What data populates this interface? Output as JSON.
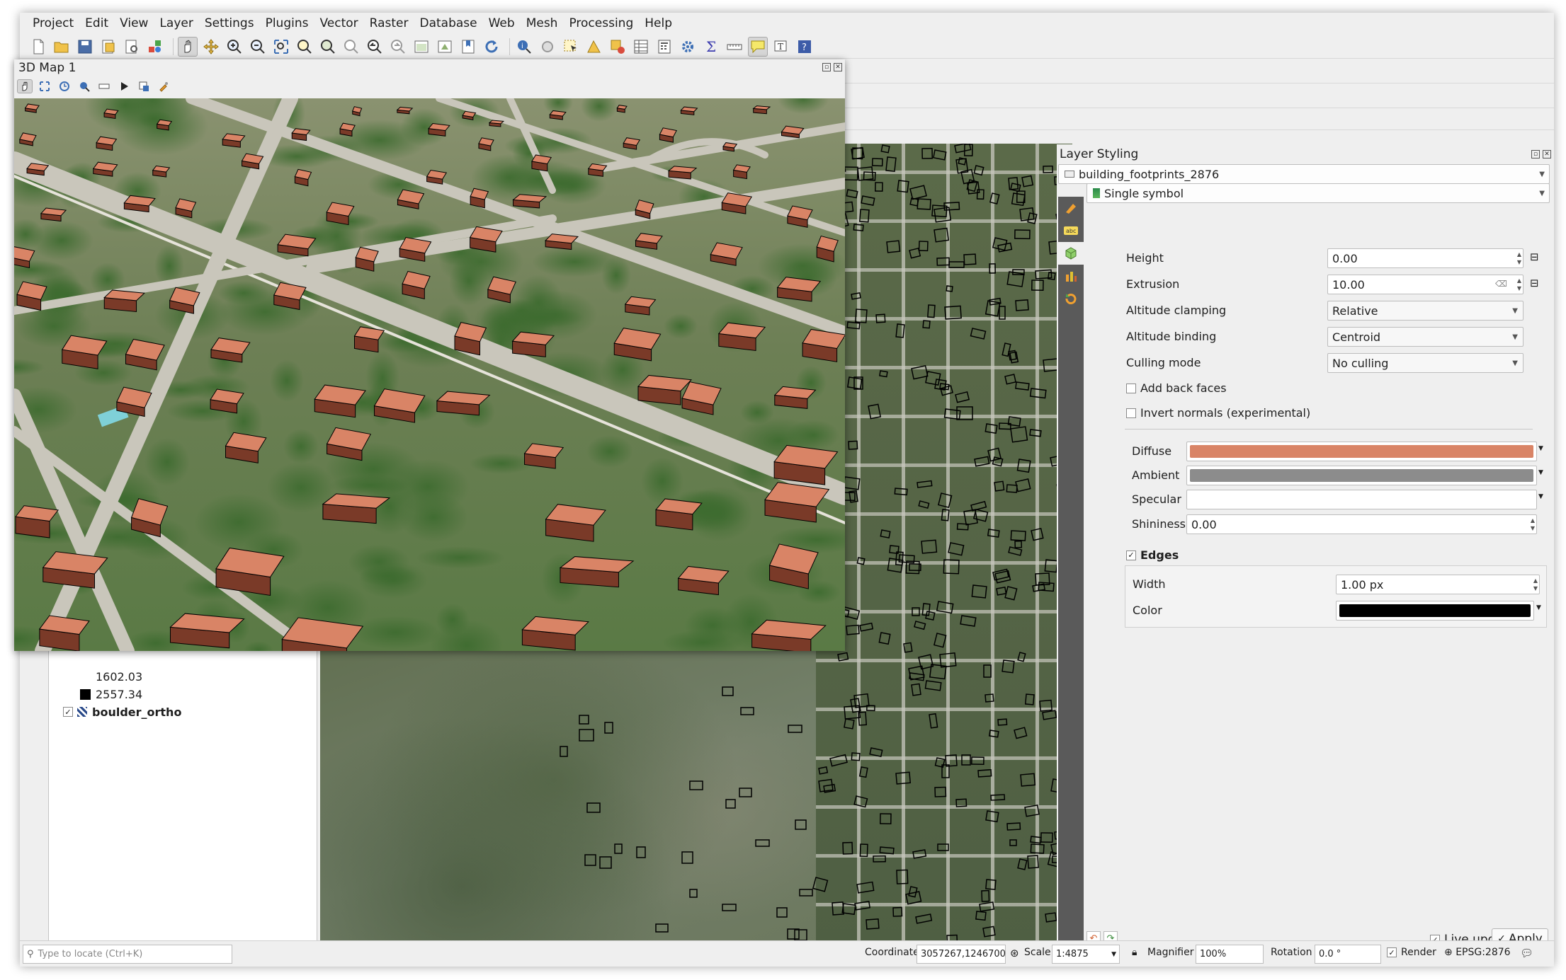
{
  "menubar": {
    "items": [
      "Project",
      "Edit",
      "View",
      "Layer",
      "Settings",
      "Plugins",
      "Vector",
      "Raster",
      "Database",
      "Web",
      "Mesh",
      "Processing",
      "Help"
    ]
  },
  "toolbar": {
    "icons": [
      "new-project-icon",
      "open-project-icon",
      "save-project-icon",
      "new-print-layout-icon",
      "layout-manager-icon",
      "style-manager-icon",
      "pan-icon",
      "pan-to-selection-icon",
      "zoom-in-icon",
      "zoom-out-icon",
      "zoom-full-icon",
      "zoom-to-selection-icon",
      "zoom-to-layer-icon",
      "zoom-native-icon",
      "zoom-last-icon",
      "zoom-next-icon",
      "new-map-view-icon",
      "new-3d-map-view-icon",
      "bookmarks-icon",
      "refresh-icon",
      "identify-icon",
      "run-action-icon",
      "select-features-icon",
      "select-by-value-icon",
      "deselect-icon",
      "attribute-table-icon",
      "field-calculator-icon",
      "processing-toolbox-icon",
      "statistics-icon",
      "measure-icon",
      "map-tips-icon",
      "text-annotation-icon",
      "help-icon"
    ]
  },
  "map3d": {
    "title": "3D Map 1",
    "toolbar_icons": [
      "camera-control-icon",
      "zoom-full-icon",
      "toggle-on-screen-navigation-icon",
      "identify-icon",
      "measure-line-icon",
      "animation-play-icon",
      "export-scene-icon",
      "configure-icon"
    ]
  },
  "layers": {
    "legend": [
      {
        "label": "1602.03",
        "color": "#ffffff"
      },
      {
        "label": "2557.34",
        "color": "#000000"
      }
    ],
    "layer": {
      "name": "boulder_ortho",
      "checked": true
    }
  },
  "styling": {
    "title": "Layer Styling",
    "layer_combo": "building_footprints_2876",
    "renderer_combo": "Single symbol",
    "height": {
      "label": "Height",
      "value": "0.00"
    },
    "extrusion": {
      "label": "Extrusion",
      "value": "10.00"
    },
    "altitude_clamping": {
      "label": "Altitude clamping",
      "value": "Relative"
    },
    "altitude_binding": {
      "label": "Altitude binding",
      "value": "Centroid"
    },
    "culling_mode": {
      "label": "Culling mode",
      "value": "No culling"
    },
    "add_back_faces": {
      "label": "Add back faces",
      "checked": false
    },
    "invert_normals": {
      "label": "Invert normals (experimental)",
      "checked": false
    },
    "diffuse": {
      "label": "Diffuse",
      "color": "#d98466"
    },
    "ambient": {
      "label": "Ambient",
      "color": "#8c8c8c"
    },
    "specular": {
      "label": "Specular",
      "color": "#ffffff"
    },
    "shininess": {
      "label": "Shininess",
      "value": "0.00"
    },
    "edges": {
      "label": "Edges",
      "checked": true
    },
    "edge_width": {
      "label": "Width",
      "value": "1.00 px"
    },
    "edge_color": {
      "label": "Color",
      "color": "#000000"
    },
    "live_update": {
      "label": "Live update",
      "checked": true
    },
    "apply_label": "Apply"
  },
  "statusbar": {
    "locator_placeholder": "Type to locate (Ctrl+K)",
    "coordinate_label": "Coordinate",
    "coordinate_value": "3057267,1246700",
    "scale_label": "Scale",
    "scale_value": "1:4875",
    "magnifier_label": "Magnifier",
    "magnifier_value": "100%",
    "rotation_label": "Rotation",
    "rotation_value": "0.0 °",
    "render_label": "Render",
    "render_checked": true,
    "crs_label": "EPSG:2876"
  },
  "colors": {
    "building": "#d98466",
    "building_dark": "#7a3a28"
  }
}
